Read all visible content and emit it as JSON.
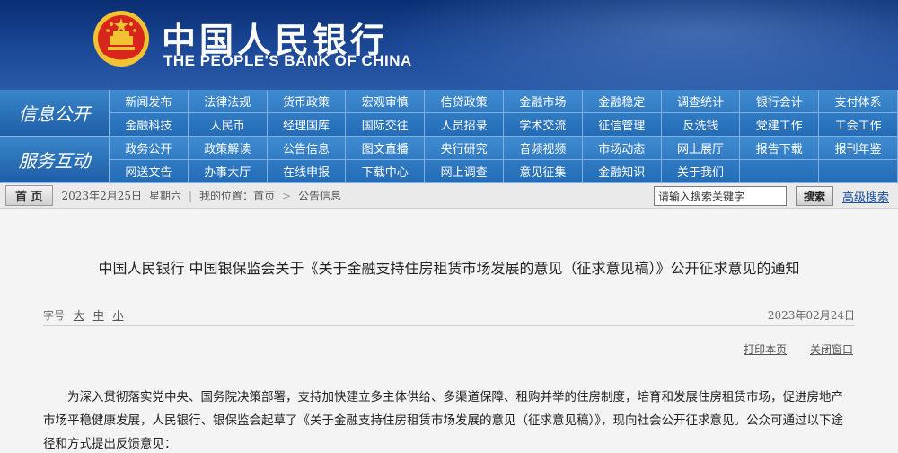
{
  "header": {
    "bank_cn": "中国人民银行",
    "bank_en": "THE PEOPLE'S BANK OF CHINA",
    "emblem_icon": "national-emblem-icon",
    "colors": {
      "header_bg": "#0a2e73",
      "nav_bg": "#2a72bd",
      "emblem_red": "#d8261c",
      "emblem_gold": "#f3c233"
    }
  },
  "nav": {
    "group1_label": "信息公开",
    "group1_items": [
      "新闻发布",
      "法律法规",
      "货币政策",
      "宏观审慎",
      "信贷政策",
      "金融市场",
      "金融稳定",
      "调查统计",
      "银行会计",
      "支付体系",
      "金融科技",
      "人民币",
      "经理国库",
      "国际交往",
      "人员招录",
      "学术交流",
      "征信管理",
      "反洗钱",
      "党建工作",
      "工会工作"
    ],
    "group2_label": "服务互动",
    "group2_items": [
      "政务公开",
      "政策解读",
      "公告信息",
      "图文直播",
      "央行研究",
      "音频视频",
      "市场动态",
      "网上展厅",
      "报告下载",
      "报刊年鉴",
      "网送文告",
      "办事大厅",
      "在线申报",
      "下载中心",
      "网上调查",
      "意见征集",
      "金融知识",
      "关于我们",
      "",
      ""
    ]
  },
  "crumb": {
    "home": "首 页",
    "date": "2023年2月25日",
    "weekday": "星期六",
    "location_label": "我的位置：",
    "path": [
      "首页",
      "公告信息"
    ],
    "search_value": "请输入搜索关键字",
    "search_button": "搜索",
    "advanced": "高级搜索"
  },
  "article": {
    "title": "中国人民银行  中国银保监会关于《关于金融支持住房租赁市场发展的意见（征求意见稿）》公开征求意见的通知",
    "fontsize_label": "字号",
    "fs_large": "大",
    "fs_medium": "中",
    "fs_small": "小",
    "date": "2023年02月24日",
    "print": "打印本页",
    "close": "关闭窗口",
    "body": "为深入贯彻落实党中央、国务院决策部署，支持加快建立多主体供给、多渠道保障、租购并举的住房制度，培育和发展住房租赁市场，促进房地产市场平稳健康发展，人民银行、银保监会起草了《关于金融支持住房租赁市场发展的意见（征求意见稿）》，现向社会公开征求意见。公众可通过以下途径和方式提出反馈意见："
  }
}
